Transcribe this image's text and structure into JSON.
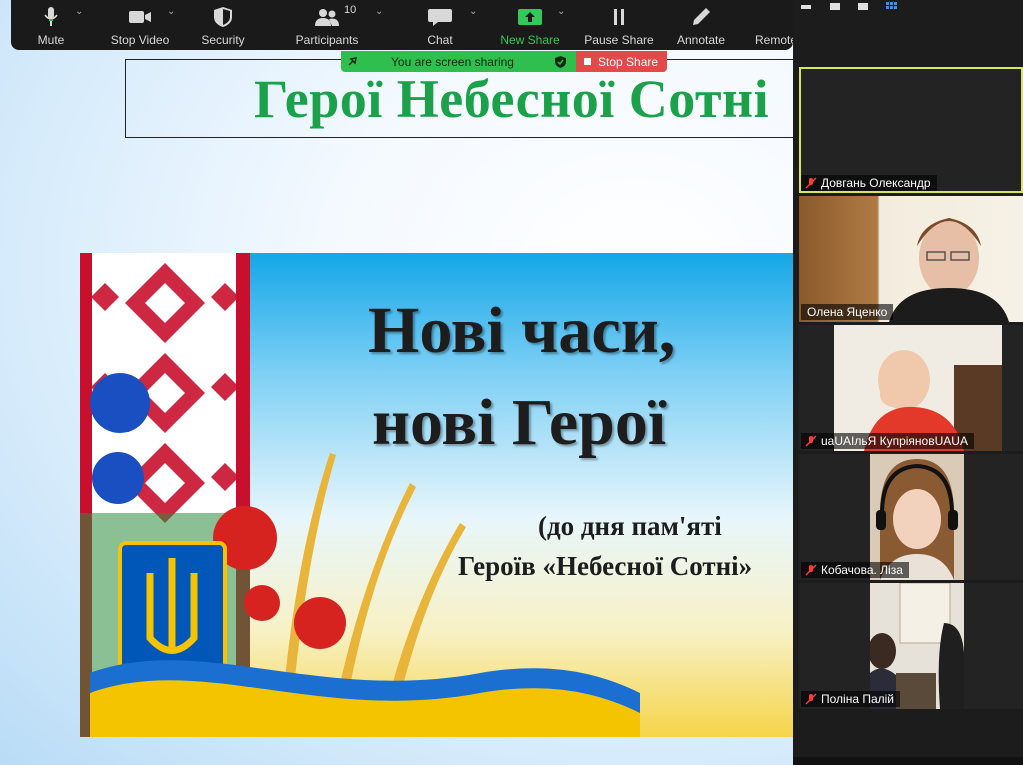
{
  "toolbar": {
    "buttons": [
      {
        "label": "Mute",
        "icon": "microphone-icon"
      },
      {
        "label": "Stop Video",
        "icon": "video-camera-icon"
      },
      {
        "label": "Security",
        "icon": "shield-icon"
      },
      {
        "label": "Participants",
        "icon": "participants-icon",
        "count": "10"
      },
      {
        "label": "Chat",
        "icon": "chat-bubble-icon"
      },
      {
        "label": "New Share",
        "icon": "share-arrow-icon"
      },
      {
        "label": "Pause Share",
        "icon": "pause-icon"
      },
      {
        "label": "Annotate",
        "icon": "pencil-icon"
      },
      {
        "label": "Remote",
        "icon": "remote-control-icon"
      }
    ]
  },
  "sharing_banner": {
    "text": "You are screen sharing",
    "stop_label": "Stop Share",
    "color": "#2fbf4f",
    "stop_color": "#e24a4a"
  },
  "slide": {
    "title": "Герої Небесної Сотні",
    "poster": {
      "line1": "Нові часи,",
      "line2": "нові Герої",
      "sub1": "(до дня пам'яті",
      "sub2": "Героїв «Небесної Сотні»"
    }
  },
  "gallery": {
    "participants": [
      {
        "name": "Довгань Олександр",
        "muted": true,
        "active": true
      },
      {
        "name": "Олена Яценко",
        "muted": false,
        "active": false
      },
      {
        "name": "uaUAІльЯ КупріяновUAUA",
        "muted": true,
        "active": false
      },
      {
        "name": "Кобачова. Ліза",
        "muted": true,
        "active": false
      },
      {
        "name": "Поліна Палій",
        "muted": true,
        "active": false
      }
    ]
  }
}
